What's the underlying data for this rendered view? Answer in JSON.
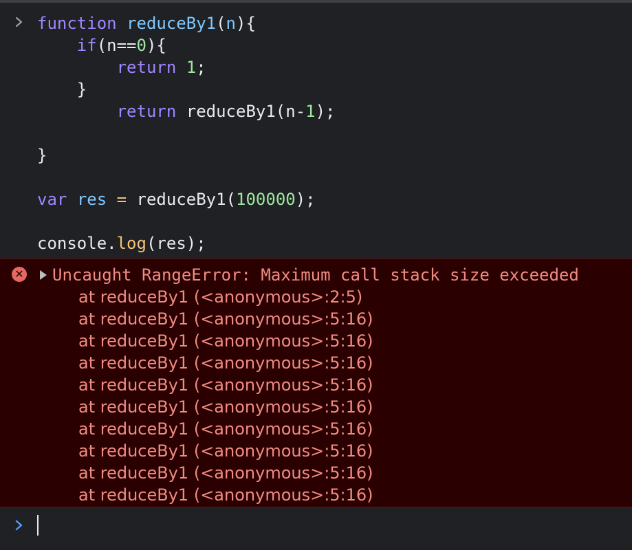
{
  "input": {
    "prompt_icon": "chevron-right-icon",
    "code_lines": {
      "l1_kw": "function",
      "l1_fn": "reduceBy1",
      "l1_paren_open": "(",
      "l1_param": "n",
      "l1_rest": "){",
      "l2_indent": "    ",
      "l2_kw": "if",
      "l2_paren": "(",
      "l2_cond_a": "n",
      "l2_op": "==",
      "l2_num": "0",
      "l2_rest": "){",
      "l3_indent": "        ",
      "l3_kw": "return",
      "l3_num": "1",
      "l3_rest": ";",
      "l4": "    }",
      "l5_indent": "        ",
      "l5_kw": "return",
      "l5_call": "reduceBy1",
      "l5_paren": "(",
      "l5_arg_a": "n",
      "l5_op": "-",
      "l5_num": "1",
      "l5_rest": ");",
      "l7": "}",
      "l9_kw": "var",
      "l9_var": "res",
      "l9_eq": "=",
      "l9_call": "reduceBy1",
      "l9_paren": "(",
      "l9_num": "100000",
      "l9_rest": ");",
      "l11_obj": "console",
      "l11_dot": ".",
      "l11_method": "log",
      "l11_rest": "(res);"
    }
  },
  "error": {
    "icon": "error-x-icon",
    "message": "Uncaught RangeError: Maximum call stack size exceeded",
    "frames": [
      "at reduceBy1 (<anonymous>:2:5)",
      "at reduceBy1 (<anonymous>:5:16)",
      "at reduceBy1 (<anonymous>:5:16)",
      "at reduceBy1 (<anonymous>:5:16)",
      "at reduceBy1 (<anonymous>:5:16)",
      "at reduceBy1 (<anonymous>:5:16)",
      "at reduceBy1 (<anonymous>:5:16)",
      "at reduceBy1 (<anonymous>:5:16)",
      "at reduceBy1 (<anonymous>:5:16)",
      "at reduceBy1 (<anonymous>:5:16)"
    ]
  },
  "prompt": {
    "icon": "chevron-right-icon",
    "value": ""
  },
  "colors": {
    "background": "#202124",
    "error_background": "#2a0000",
    "error_text": "#f28b82",
    "prompt_accent": "#4f9dff"
  }
}
